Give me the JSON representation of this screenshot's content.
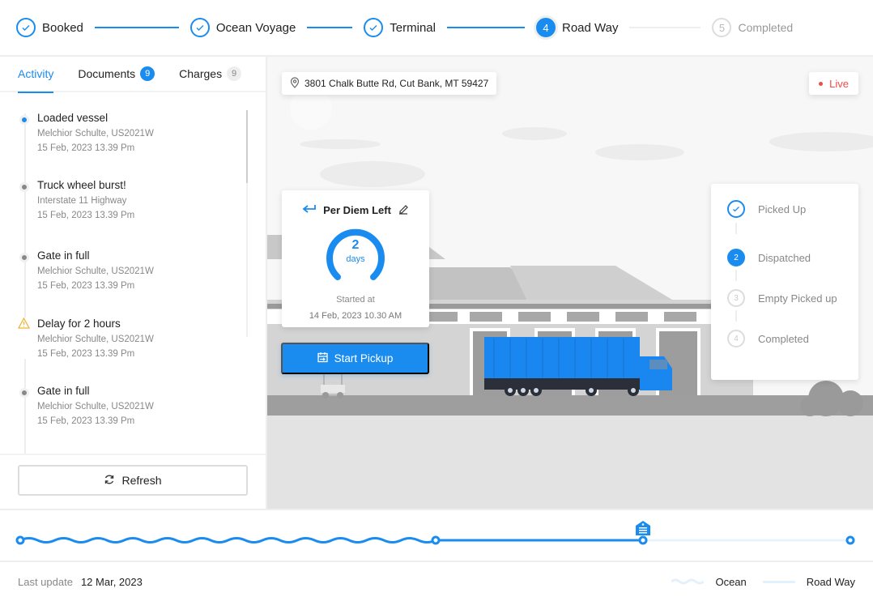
{
  "stepper": {
    "steps": [
      {
        "label": "Booked",
        "state": "done"
      },
      {
        "label": "Ocean Voyage",
        "state": "done"
      },
      {
        "label": "Terminal",
        "state": "done"
      },
      {
        "label": "Road Way",
        "state": "current",
        "number": "4"
      },
      {
        "label": "Completed",
        "state": "future",
        "number": "5"
      }
    ]
  },
  "sidebar": {
    "tabs": [
      {
        "label": "Activity",
        "active": true
      },
      {
        "label": "Documents",
        "count": "9"
      },
      {
        "label": "Charges",
        "count": "9"
      }
    ],
    "events": [
      {
        "title": "Loaded vessel",
        "detail": "Melchior Schulte, US2021W",
        "time": "15 Feb, 2023  13.39 Pm",
        "type": "current"
      },
      {
        "title": "Truck wheel burst!",
        "detail": "Interstate 11 Highway",
        "time": "15 Feb, 2023  13.39 Pm",
        "type": "normal"
      },
      {
        "title": "Gate in full",
        "detail": "Melchior Schulte, US2021W",
        "time": "15 Feb, 2023  13.39 Pm",
        "type": "normal"
      },
      {
        "title": "Delay for 2 hours",
        "detail": "Melchior Schulte, US2021W",
        "time": "15 Feb, 2023  13.39 Pm",
        "type": "warning"
      },
      {
        "title": "Gate in full",
        "detail": "Melchior Schulte, US2021W",
        "time": "15 Feb, 2023  13.39 Pm",
        "type": "normal"
      }
    ],
    "refresh_label": "Refresh"
  },
  "scene": {
    "address": "3801 Chalk Butte Rd, Cut Bank, MT 59427",
    "live_label": "Live",
    "per_diem": {
      "title": "Per Diem Left",
      "value": "2",
      "unit": "days",
      "started_label": "Started at",
      "started_date": "14 Feb, 2023 10.30 AM"
    },
    "start_pickup_label": "Start Pickup",
    "substeps": [
      {
        "label": "Picked Up",
        "state": "done"
      },
      {
        "label": "Dispatched",
        "state": "current",
        "number": "2"
      },
      {
        "label": "Empty Picked up",
        "state": "future",
        "number": "3"
      },
      {
        "label": "Completed",
        "state": "future",
        "number": "4"
      }
    ]
  },
  "route": {
    "ocean_progress": 1.0,
    "road_progress": 0.5,
    "colors": {
      "active": "#1a8cf0",
      "inactive": "#e8f4fd"
    }
  },
  "footer": {
    "last_update_label": "Last update",
    "last_update_value": "12 Mar, 2023",
    "legend": {
      "ocean": "Ocean",
      "road": "Road Way"
    }
  }
}
